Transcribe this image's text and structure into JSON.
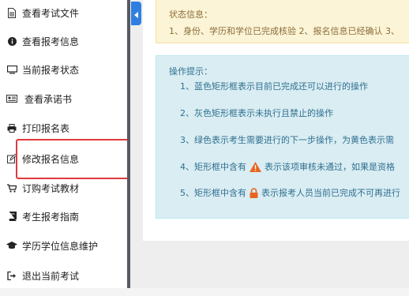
{
  "sidebar": {
    "items": [
      {
        "icon": "file-text-icon",
        "label": "查看考试文件"
      },
      {
        "icon": "info-circle-icon",
        "label": "查看报考信息"
      },
      {
        "icon": "monitor-icon",
        "label": "当前报考状态"
      },
      {
        "icon": "id-card-icon",
        "label": "查看承诺书"
      },
      {
        "icon": "print-icon",
        "label": "打印报名表"
      },
      {
        "icon": "edit-icon",
        "label": "修改报名信息"
      },
      {
        "icon": "cart-icon",
        "label": "订购考试教材"
      },
      {
        "icon": "book-icon",
        "label": "考生报考指南"
      },
      {
        "icon": "graduation-cap-icon",
        "label": "学历学位信息维护"
      },
      {
        "icon": "sign-out-icon",
        "label": "退出当前考试"
      }
    ]
  },
  "status": {
    "title": "状态信息：",
    "text": "1、身份、学历和学位已完成核验 2、报名信息已经确认 3、"
  },
  "tips": {
    "title": "操作提示：",
    "items": [
      "1、蓝色矩形框表示目前已完成还可以进行的操作",
      "2、灰色矩形框表示未执行且禁止的操作",
      "3、绿色表示考生需要进行的下一步操作，为黄色表示需",
      "4、矩形框中含有",
      "表示该项审核未通过，如果是资格",
      "5、矩形框中含有",
      "表示报考人员当前已完成不可再进行"
    ]
  },
  "colors": {
    "accent": "#2f7fe0",
    "highlight": "#e0393b",
    "warning_icon": "#e8651e",
    "lock_icon": "#e8651e"
  }
}
